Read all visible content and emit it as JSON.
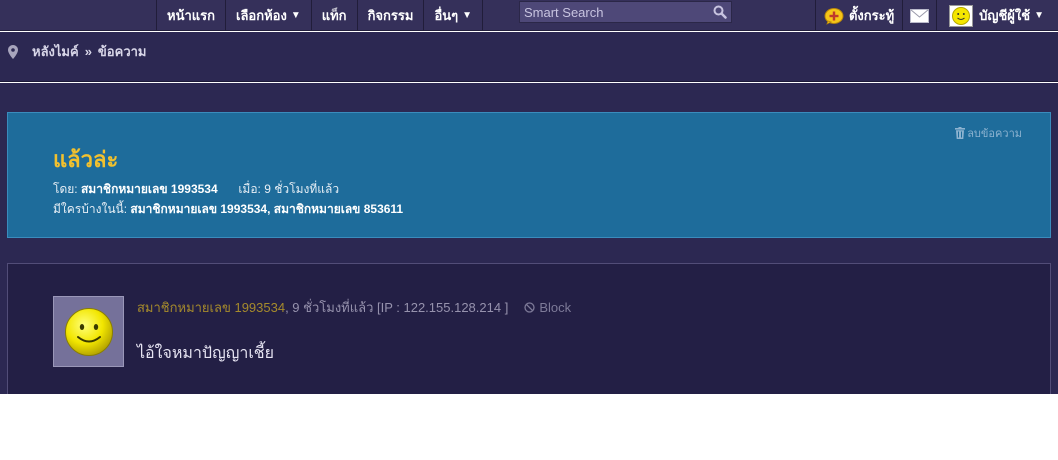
{
  "nav": {
    "items": [
      {
        "label": "หน้าแรก",
        "caret": ""
      },
      {
        "label": "เลือกห้อง",
        "caret": "▼"
      },
      {
        "label": "แท็ก",
        "caret": ""
      },
      {
        "label": "กิจกรรม",
        "caret": ""
      },
      {
        "label": "อื่นๆ",
        "caret": "▼"
      }
    ],
    "search_placeholder": "Smart Search",
    "new_topic_label": "ตั้งกระทู้",
    "account_label": "บัญชีผู้ใช้",
    "account_caret": "▼"
  },
  "breadcrumb": {
    "home": "หลังไมค์",
    "separator": "»",
    "current": "ข้อความ"
  },
  "topic": {
    "delete_label": "ลบข้อความ",
    "title": "แล้วล่ะ",
    "by_label": "โดย:",
    "author": "สมาชิกหมายเลข 1993534",
    "when_label": "เมื่อ:",
    "when": "9 ชั่วโมงที่แล้ว",
    "participants_label": "มีใครบ้างในนี้:",
    "participants": "สมาชิกหมายเลข 1993534, สมาชิกหมายเลข 853611"
  },
  "post": {
    "author": "สมาชิกหมายเลข 1993534",
    "time_ip": ", 9 ชั่วโมงที่แล้ว [IP : 122.155.128.214 ]",
    "block_label": "Block",
    "body": "ไอ้ใจหมาปัญญาเชี้ย"
  },
  "colors": {
    "nav_bg": "#35305a",
    "page_bg": "#2c2852",
    "topic_bg": "#1e6c9b",
    "title_yellow": "#f2c12e",
    "post_bg": "#231f45"
  }
}
